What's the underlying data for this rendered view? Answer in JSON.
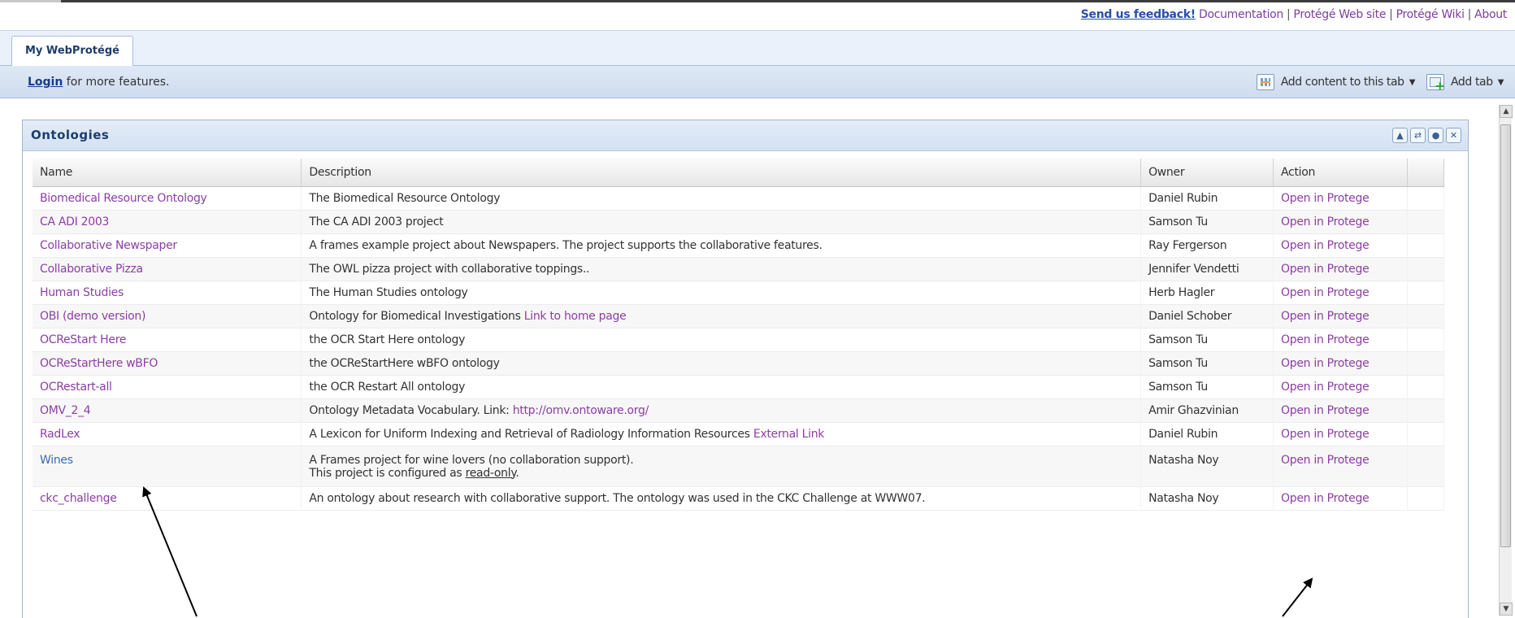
{
  "toplinks": {
    "feedback": "Send us feedback!",
    "documentation": "Documentation",
    "website": "Protégé Web site",
    "wiki": "Protégé Wiki",
    "about": "About"
  },
  "tabs": [
    {
      "label": "My WebProtégé",
      "active": true
    }
  ],
  "loginbar": {
    "login_link": "Login",
    "login_suffix": " for more features.",
    "add_content_label": "Add content to this tab",
    "add_tab_label": "Add tab"
  },
  "portlet": {
    "title": "Ontologies",
    "buttons": [
      "collapse-icon",
      "refresh-icon",
      "settings-icon",
      "close-icon"
    ]
  },
  "table": {
    "headers": {
      "name": "Name",
      "description": "Description",
      "owner": "Owner",
      "action": "Action"
    },
    "rows": [
      {
        "name": "Biomedical Resource Ontology",
        "desc": "The Biomedical Resource Ontology",
        "link": "",
        "owner": "Daniel Rubin",
        "action": "Open in Protege"
      },
      {
        "name": "CA ADI 2003",
        "desc": "The CA ADI 2003 project",
        "link": "",
        "owner": "Samson Tu",
        "action": "Open in Protege"
      },
      {
        "name": "Collaborative Newspaper",
        "desc": "A frames example project about Newspapers. The project supports the collaborative features.",
        "link": "",
        "owner": "Ray Fergerson",
        "action": "Open in Protege"
      },
      {
        "name": "Collaborative Pizza",
        "desc": "The OWL pizza project with collaborative toppings..",
        "link": "",
        "owner": "Jennifer Vendetti",
        "action": "Open in Protege"
      },
      {
        "name": "Human Studies",
        "desc": "The Human Studies ontology",
        "link": "",
        "owner": "Herb Hagler",
        "action": "Open in Protege"
      },
      {
        "name": "OBI (demo version)",
        "desc": "Ontology for Biomedical Investigations ",
        "link": "Link to home page",
        "owner": "Daniel Schober",
        "action": "Open in Protege"
      },
      {
        "name": "OCReStart Here",
        "desc": "the OCR Start Here ontology",
        "link": "",
        "owner": "Samson Tu",
        "action": "Open in Protege"
      },
      {
        "name": "OCReStartHere wBFO",
        "desc": "the OCReStartHere wBFO ontology",
        "link": "",
        "owner": "Samson Tu",
        "action": "Open in Protege"
      },
      {
        "name": "OCRestart-all",
        "desc": "the OCR Restart All ontology",
        "link": "",
        "owner": "Samson Tu",
        "action": "Open in Protege"
      },
      {
        "name": "OMV_2_4",
        "desc": "Ontology Metadata Vocabulary. Link: ",
        "link": "http://omv.ontoware.org/",
        "owner": "Amir Ghazvinian",
        "action": "Open in Protege"
      },
      {
        "name": "RadLex",
        "desc": "A Lexicon for Uniform Indexing and Retrieval of Radiology Information Resources ",
        "link": "External Link",
        "owner": "Daniel Rubin",
        "action": "Open in Protege"
      }
    ],
    "wines": {
      "name": "Wines",
      "desc_line1": "A Frames project for wine lovers (no collaboration support).",
      "desc_line2_prefix": "This project is configured as ",
      "desc_line2_ro": "read-only",
      "desc_line2_suffix": ".",
      "owner": "Natasha Noy",
      "action": "Open in Protege"
    },
    "last": {
      "name": "ckc_challenge",
      "desc": "An ontology about research with collaborative support. The ontology was used in the CKC Challenge at WWW07.",
      "owner": "Natasha Noy",
      "action": "Open in Protege"
    }
  },
  "colors": {
    "link_purple": "#8c3ea3",
    "link_blue": "#3c6bb2",
    "header_blue": "#1e3d6b",
    "bar_bg": "#dfe9f6"
  }
}
